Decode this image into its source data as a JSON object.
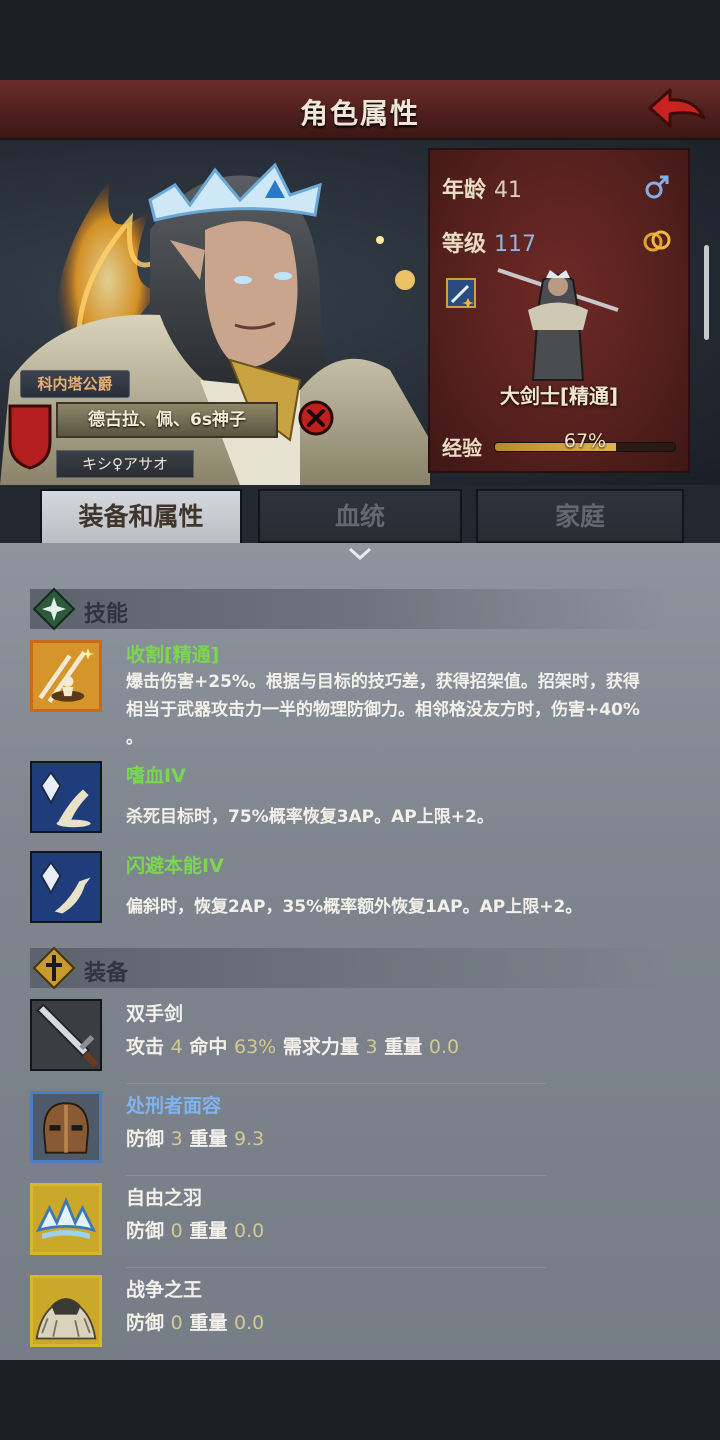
{
  "header": {
    "title": "角色属性"
  },
  "character": {
    "house": "科内塔公爵",
    "name": "德古拉、佩、6s神子",
    "title_line": "キシ♀アサオ",
    "age_label": "年龄",
    "age": "41",
    "level_label": "等级",
    "level": "117",
    "class_name": "大剑士[精通]",
    "exp_label": "经验",
    "exp_percent": "67%",
    "exp_fraction": 0.67
  },
  "tabs": [
    {
      "label": "装备和属性",
      "active": true
    },
    {
      "label": "血统",
      "active": false
    },
    {
      "label": "家庭",
      "active": false
    }
  ],
  "skills": {
    "title": "技能",
    "items": [
      {
        "name": "收割[精通]",
        "desc_lines": [
          "爆击伤害+25%。根据与目标的技巧差，获得招架值。招架时，获得",
          "相当于武器攻击力一半的物理防御力。相邻格没友方时，伤害+40%",
          "。"
        ]
      },
      {
        "name": "嗜血IV",
        "desc_lines": [
          "杀死目标时，75%概率恢复3AP。AP上限+2。"
        ]
      },
      {
        "name": "闪避本能IV",
        "desc_lines": [
          "偏斜时，恢复2AP，35%概率额外恢复1AP。AP上限+2。"
        ]
      }
    ]
  },
  "equipment": {
    "title": "装备",
    "items": [
      {
        "name": "双手剑",
        "stats": [
          [
            "攻击",
            "4"
          ],
          [
            "命中",
            "63%"
          ],
          [
            "需求力量",
            "3"
          ],
          [
            "重量",
            "0.0"
          ]
        ]
      },
      {
        "name": "处刑者面容",
        "stats": [
          [
            "防御",
            "3"
          ],
          [
            "重量",
            "9.3"
          ]
        ]
      },
      {
        "name": "自由之羽",
        "stats": [
          [
            "防御",
            "0"
          ],
          [
            "重量",
            "0.0"
          ]
        ]
      },
      {
        "name": "战争之王",
        "stats": [
          [
            "防御",
            "0"
          ],
          [
            "重量",
            "0.0"
          ]
        ]
      }
    ]
  },
  "colors": {
    "title_bar": "#5a2624",
    "skill_name": "#7bd650",
    "rare_name": "#7fb4f0",
    "stat_value": "#d3c991"
  }
}
